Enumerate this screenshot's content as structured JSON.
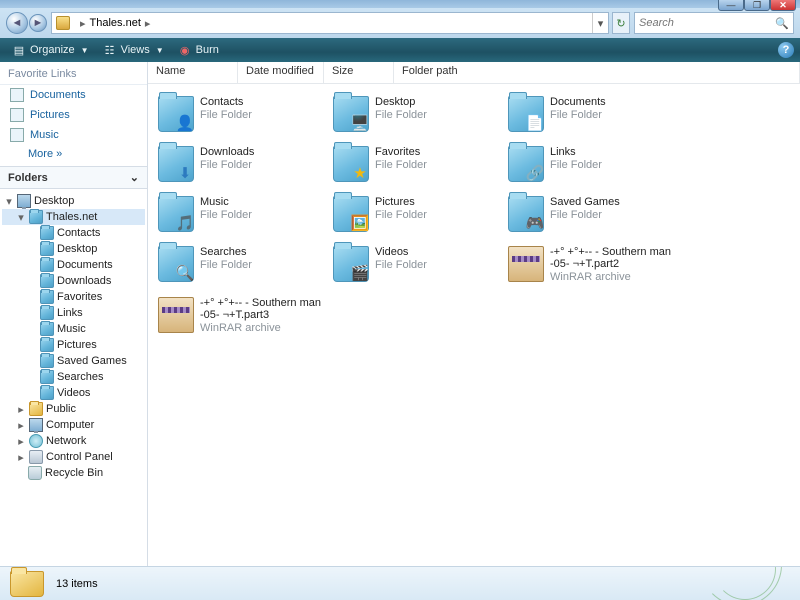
{
  "breadcrumb": {
    "location": "Thales.net"
  },
  "search": {
    "placeholder": "Search"
  },
  "toolbar": {
    "organize": "Organize",
    "views": "Views",
    "burn": "Burn"
  },
  "sidebar": {
    "fav_header": "Favorite Links",
    "docs": "Documents",
    "pics": "Pictures",
    "music": "Music",
    "more": "More  »",
    "folders_header": "Folders",
    "tree": {
      "desktop": "Desktop",
      "thales": "Thales.net",
      "contacts": "Contacts",
      "t_desktop": "Desktop",
      "t_documents": "Documents",
      "t_downloads": "Downloads",
      "t_favorites": "Favorites",
      "t_links": "Links",
      "t_music": "Music",
      "t_pictures": "Pictures",
      "t_saved": "Saved Games",
      "t_searches": "Searches",
      "t_videos": "Videos",
      "public": "Public",
      "computer": "Computer",
      "network": "Network",
      "cpanel": "Control Panel",
      "bin": "Recycle Bin"
    }
  },
  "columns": {
    "name": "Name",
    "dm": "Date modified",
    "size": "Size",
    "fp": "Folder path"
  },
  "type_folder": "File Folder",
  "type_rar": "WinRAR archive",
  "items": {
    "contacts": "Contacts",
    "desktop": "Desktop",
    "documents": "Documents",
    "downloads": "Downloads",
    "favorites": "Favorites",
    "links": "Links",
    "music": "Music",
    "pictures": "Pictures",
    "saved": "Saved Games",
    "searches": "Searches",
    "videos": "Videos",
    "rar2": "-+° +°+-- - Southern man -05- ¬+T.part2",
    "rar3": "-+° +°+-- - Southern man -05- ¬+T.part3"
  },
  "status": {
    "count": "13 items"
  }
}
